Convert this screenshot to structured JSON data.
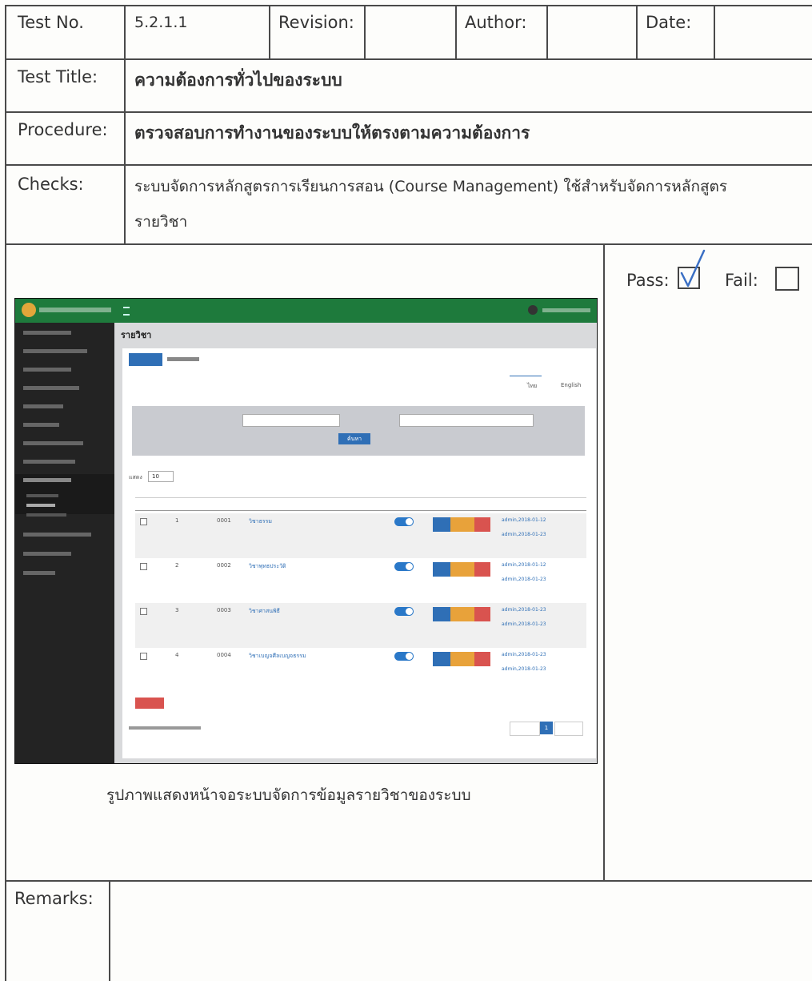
{
  "header": {
    "test_no_label": "Test No.",
    "test_no_value": "5.2.1.1",
    "revision_label": "Revision:",
    "author_label": "Author:",
    "date_label": "Date:"
  },
  "test_title": {
    "label": "Test Title:",
    "value": "ความต้องการทั่วไปของระบบ"
  },
  "procedure": {
    "label": "Procedure:",
    "value": "ตรวจสอบการทำงานของระบบให้ตรงตามความต้องการ"
  },
  "checks": {
    "label": "Checks:",
    "line1": "ระบบจัดการหลักสูตรการเรียนการสอน (Course Management) ใช้สำหรับจัดการหลักสูตร",
    "line2": "รายวิชา"
  },
  "result": {
    "pass_label": "Pass:",
    "fail_label": "Fail:",
    "pass_checked": true,
    "fail_checked": false
  },
  "caption": "รูปภาพแสดงหน้าจอระบบจัดการข้อมูลรายวิชาของระบบ",
  "remarks": {
    "label": "Remarks:"
  },
  "screenshot": {
    "page_title": "รายวิชา",
    "lang_thai": "ไทย",
    "lang_english": "English",
    "search_button": "ค้นหา",
    "show_label": "แสดง",
    "page_size": "10",
    "rows": [
      {
        "no": "1",
        "code": "0001",
        "name": "วิชาธรรม",
        "created": "admin,2018-01-12",
        "updated": "admin,2018-01-23"
      },
      {
        "no": "2",
        "code": "0002",
        "name": "วิชาพุทธประวัติ",
        "created": "admin,2018-01-12",
        "updated": "admin,2018-01-23"
      },
      {
        "no": "3",
        "code": "0003",
        "name": "วิชาศาสนพิธี",
        "created": "admin,2018-01-23",
        "updated": "admin,2018-01-23"
      },
      {
        "no": "4",
        "code": "0004",
        "name": "วิชาเบญจศีลเบญจธรรม",
        "created": "admin,2018-01-23",
        "updated": "admin,2018-01-23"
      }
    ],
    "page_number": "1"
  },
  "colors": {
    "ink": "#333333",
    "rule": "#4a4a4a",
    "check_blue": "#3a6fc4",
    "header_green": "#1e7a3c"
  }
}
